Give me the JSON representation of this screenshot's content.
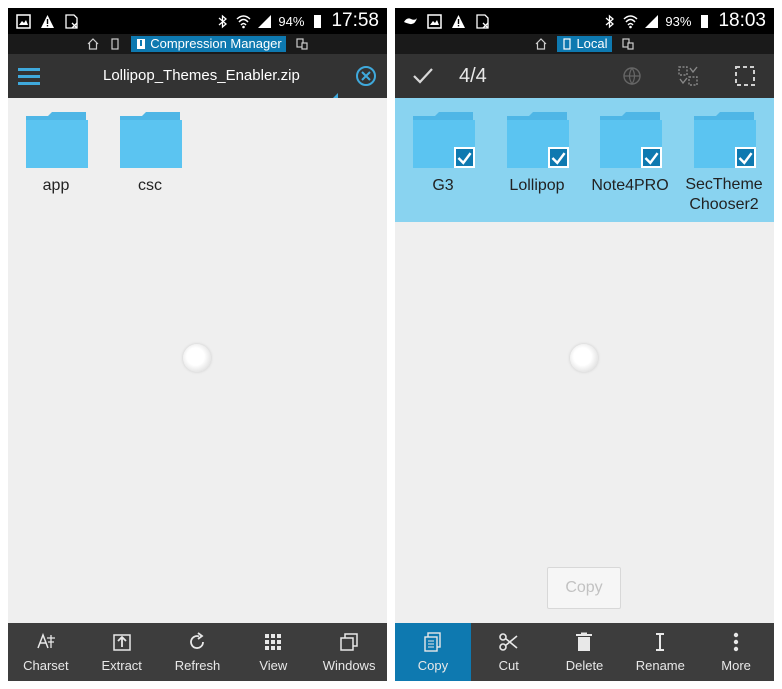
{
  "left": {
    "status": {
      "battery": "94%",
      "time": "17:58"
    },
    "subbar": {
      "active_tab": "Compression Manager"
    },
    "toolbar": {
      "title": "Lollipop_Themes_Enabler.zip"
    },
    "folders": [
      {
        "name": "app"
      },
      {
        "name": "csc"
      }
    ],
    "bottom": [
      {
        "label": "Charset",
        "icon": "charset-icon"
      },
      {
        "label": "Extract",
        "icon": "extract-icon"
      },
      {
        "label": "Refresh",
        "icon": "refresh-icon"
      },
      {
        "label": "View",
        "icon": "grid-view-icon"
      },
      {
        "label": "Windows",
        "icon": "windows-icon"
      }
    ]
  },
  "right": {
    "status": {
      "battery": "93%",
      "time": "18:03"
    },
    "subbar": {
      "active_tab": "Local"
    },
    "toolbar": {
      "count": "4/4"
    },
    "folders": [
      {
        "name": "G3",
        "checked": true
      },
      {
        "name": "Lollipop",
        "checked": true
      },
      {
        "name": "Note4PRO",
        "checked": true
      },
      {
        "name_line1": "SecTheme",
        "name_line2": "Chooser2",
        "checked": true
      }
    ],
    "floating_copy": "Copy",
    "bottom": [
      {
        "label": "Copy",
        "icon": "copy-icon",
        "active": true
      },
      {
        "label": "Cut",
        "icon": "cut-icon"
      },
      {
        "label": "Delete",
        "icon": "delete-icon"
      },
      {
        "label": "Rename",
        "icon": "rename-icon"
      },
      {
        "label": "More",
        "icon": "more-icon"
      }
    ]
  },
  "colors": {
    "accent": "#0e79b0",
    "folder": "#5bc4f1",
    "selection": "#89d3f0",
    "toolbar": "#333333",
    "bottombar": "#3d3d3d"
  }
}
